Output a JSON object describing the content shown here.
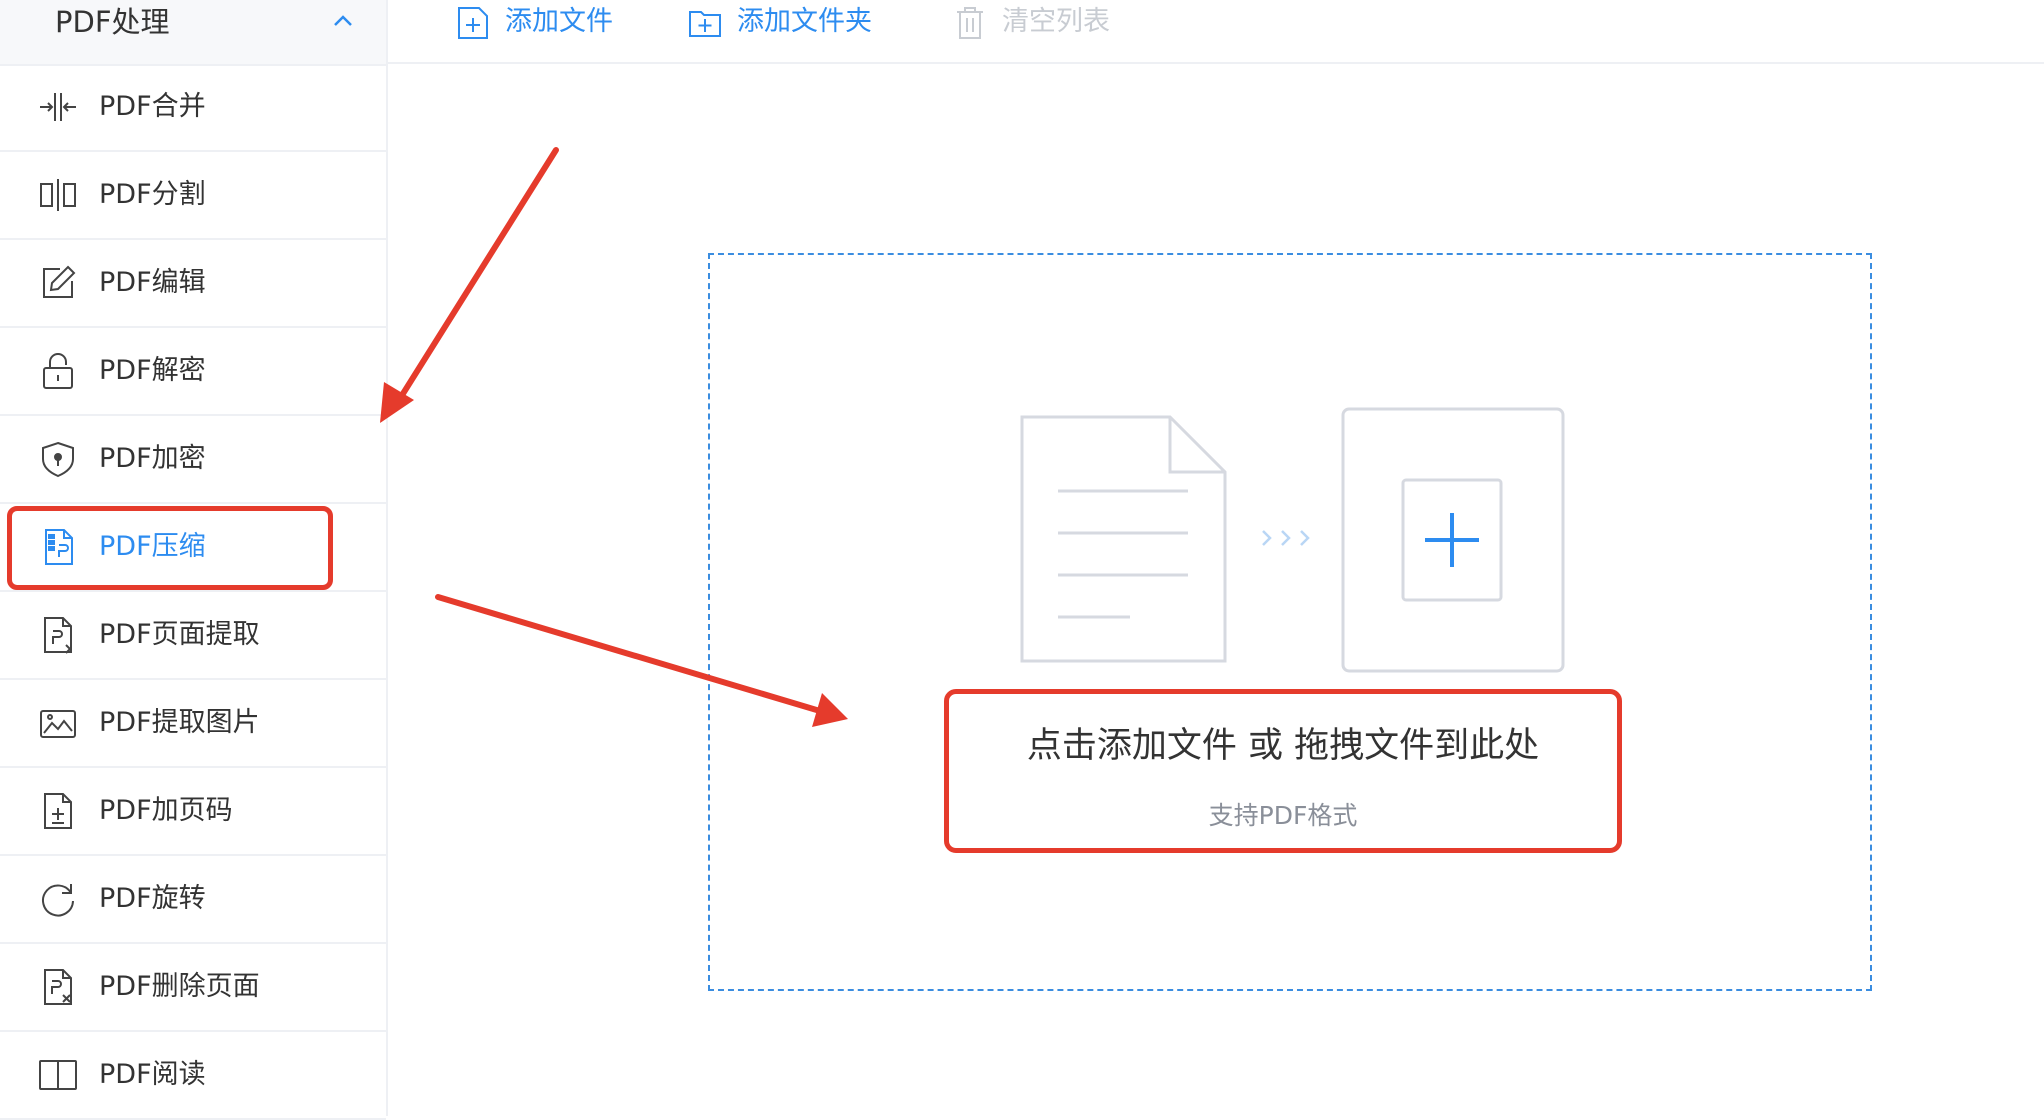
{
  "sidebar": {
    "header_title": "PDF处理",
    "items": [
      {
        "label": "PDF合并",
        "icon": "merge-icon"
      },
      {
        "label": "PDF分割",
        "icon": "split-icon"
      },
      {
        "label": "PDF编辑",
        "icon": "edit-icon"
      },
      {
        "label": "PDF解密",
        "icon": "unlock-icon"
      },
      {
        "label": "PDF加密",
        "icon": "shield-lock-icon"
      },
      {
        "label": "PDF压缩",
        "icon": "compress-file-icon",
        "active": true
      },
      {
        "label": "PDF页面提取",
        "icon": "page-extract-icon"
      },
      {
        "label": "PDF提取图片",
        "icon": "image-extract-icon"
      },
      {
        "label": "PDF加页码",
        "icon": "page-number-icon"
      },
      {
        "label": "PDF旋转",
        "icon": "rotate-icon"
      },
      {
        "label": "PDF删除页面",
        "icon": "delete-page-icon"
      },
      {
        "label": "PDF阅读",
        "icon": "book-icon"
      }
    ]
  },
  "toolbar": {
    "add_file": "添加文件",
    "add_folder": "添加文件夹",
    "clear_list": "清空列表"
  },
  "dropzone": {
    "main_text": "点击添加文件 或 拖拽文件到此处",
    "sub_text": "支持PDF格式"
  },
  "colors": {
    "accent": "#2d8cf0",
    "annotation_red": "#e53b2c",
    "disabled_text": "#c8ccd2"
  }
}
